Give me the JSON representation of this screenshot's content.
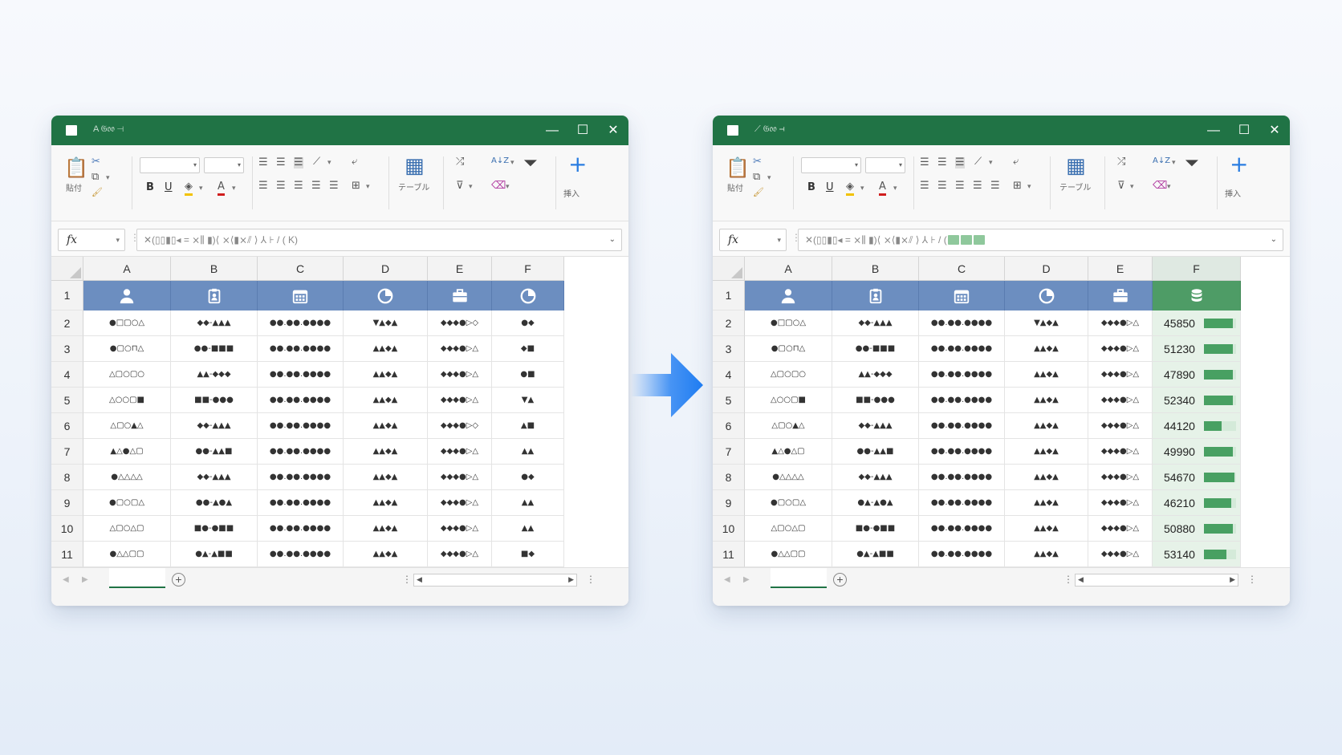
{
  "windows": [
    {
      "id": "left",
      "title": "A 𝔊𝔬𝔬 ⊣",
      "ribbon": {
        "paste_label": "貼付",
        "table_label": "テーブル",
        "insert_label": "挿入",
        "bold": "B",
        "underline": "U",
        "font_color_glyph": "A",
        "sort_glyph": "A↓Z"
      },
      "formula_text": "✕(▯▯▮▯◂ = ⨯⫼ ▮)⟨ ⨯⟨▮⨯⫽ ⟩ ⅄ ⊦ / ( K)",
      "formula_has_green": false,
      "columns": [
        "A",
        "B",
        "C",
        "D",
        "E",
        "F"
      ],
      "header_icons": [
        "person-icon",
        "badge-icon",
        "calendar-icon",
        "pie-chart-icon",
        "briefcase-icon",
        "pie-chart-icon"
      ],
      "row_numbers": [
        "1",
        "2",
        "3",
        "4",
        "5",
        "6",
        "7",
        "8",
        "9",
        "10",
        "11"
      ],
      "rows": [
        [
          "●□▢○△",
          "◆◆-▲▲▲",
          "●●.●●.●●●●",
          "▼▲◆▲",
          "◆◆◆●▷◇",
          "●◆"
        ],
        [
          "●▢○⊓△",
          "●●-■■■",
          "●●.●●.●●●●",
          "▲▲◆▲",
          "◆◆◆●▷△",
          "◆■"
        ],
        [
          "△▢○▢○",
          "▲▲-◆◆◆",
          "●●.●●.●●●●",
          "▲▲◆▲",
          "◆◆◆●▷△",
          "●■"
        ],
        [
          "△○○▢■",
          "■■-●●●",
          "●●.●●.●●●●",
          "▲▲◆▲",
          "◆◆◆●▷△",
          "▼▲"
        ],
        [
          "△▢○▲△",
          "◆◆-▲▲▲",
          "●●.●●.●●●●",
          "▲▲◆▲",
          "◆◆◆●▷◇",
          "▲■"
        ],
        [
          "▲△●△▢",
          "●●-▲▲■",
          "●●.●●.●●●●",
          "▲▲◆▲",
          "◆◆◆●▷△",
          "▲▲"
        ],
        [
          "●△△△△",
          "◆◆-▲▲▲",
          "●●.●●.●●●●",
          "▲▲◆▲",
          "◆◆◆●▷△",
          "●◆"
        ],
        [
          "●▢○▢△",
          "●●-▲●▲",
          "●●.●●.●●●●",
          "▲▲◆▲",
          "◆◆◆●▷△",
          "▲▲"
        ],
        [
          "△▢○△▢",
          "■●-●■■",
          "●●.●●.●●●●",
          "▲▲◆▲",
          "◆◆◆●▷△",
          "▲▲"
        ],
        [
          "●△△▢▢",
          "●▲-▲■■",
          "●●.●●.●●●●",
          "▲▲◆▲",
          "◆◆◆●▷△",
          "■◆"
        ]
      ],
      "highlight_F": false,
      "F_values": [],
      "F_bar_fractions": []
    },
    {
      "id": "right",
      "title": "⟋ 𝔊𝔬𝔬 ⊣",
      "ribbon": {
        "paste_label": "貼付",
        "table_label": "テーブル",
        "insert_label": "挿入",
        "bold": "B",
        "underline": "U",
        "font_color_glyph": "A",
        "sort_glyph": "A↓Z"
      },
      "formula_text": "✕(▯▯▮▯◂ = ⨯⫼ ▮)⟨ ⨯⟨▮⨯⫽ ⟩ ⅄ ⊦ / (",
      "formula_has_green": true,
      "columns": [
        "A",
        "B",
        "C",
        "D",
        "E",
        "F"
      ],
      "header_icons": [
        "person-icon",
        "badge-icon",
        "calendar-icon",
        "pie-chart-icon",
        "briefcase-icon",
        "database-icon"
      ],
      "row_numbers": [
        "1",
        "2",
        "3",
        "4",
        "5",
        "6",
        "7",
        "8",
        "9",
        "10",
        "11"
      ],
      "rows": [
        [
          "●□▢○△",
          "◆◆-▲▲▲",
          "●●.●●.●●●●",
          "▼▲◆▲",
          "◆◆◆●▷△",
          "45850"
        ],
        [
          "●▢○⊓△",
          "●●-■■■",
          "●●.●●.●●●●",
          "▲▲◆▲",
          "◆◆◆●▷△",
          "51230"
        ],
        [
          "△▢○▢○",
          "▲▲-◆◆◆",
          "●●.●●.●●●●",
          "▲▲◆▲",
          "◆◆◆●▷△",
          "47890"
        ],
        [
          "△○○▢■",
          "■■-●●●",
          "●●.●●.●●●●",
          "▲▲◆▲",
          "◆◆◆●▷△",
          "52340"
        ],
        [
          "△▢○▲△",
          "◆◆-▲▲▲",
          "●●.●●.●●●●",
          "▲▲◆▲",
          "◆◆◆●▷△",
          "44120"
        ],
        [
          "▲△●△▢",
          "●●-▲▲■",
          "●●.●●.●●●●",
          "▲▲◆▲",
          "◆◆◆●▷△",
          "49990"
        ],
        [
          "●△△△△",
          "◆◆-▲▲▲",
          "●●.●●.●●●●",
          "▲▲◆▲",
          "◆◆◆●▷△",
          "54670"
        ],
        [
          "●▢○▢△",
          "●▲-▲●▲",
          "●●.●●.●●●●",
          "▲▲◆▲",
          "◆◆◆●▷△",
          "46210"
        ],
        [
          "△▢○△▢",
          "■●-●■■",
          "●●.●●.●●●●",
          "▲▲◆▲",
          "◆◆◆●▷△",
          "50880"
        ],
        [
          "●△△▢▢",
          "●▲-▲■■",
          "●●.●●.●●●●",
          "▲▲◆▲",
          "◆◆◆●▷△",
          "53140"
        ]
      ],
      "highlight_F": true,
      "F_values": [
        45850,
        51230,
        47890,
        52340,
        44120,
        49990,
        54670,
        46210,
        50880,
        53140
      ],
      "F_bar_fractions": [
        0.9,
        0.9,
        0.9,
        0.9,
        0.55,
        0.9,
        0.95,
        0.85,
        0.9,
        0.7
      ]
    }
  ],
  "colors": {
    "titlebar": "#207345",
    "header_fill": "#6c8ec0",
    "highlight_header": "#4e9c66",
    "highlight_cell": "#e6f2e8",
    "data_bar": "#48a062",
    "arrow_blue": "#1e7cf2"
  },
  "transition": {
    "icon": "right-arrow-icon"
  }
}
